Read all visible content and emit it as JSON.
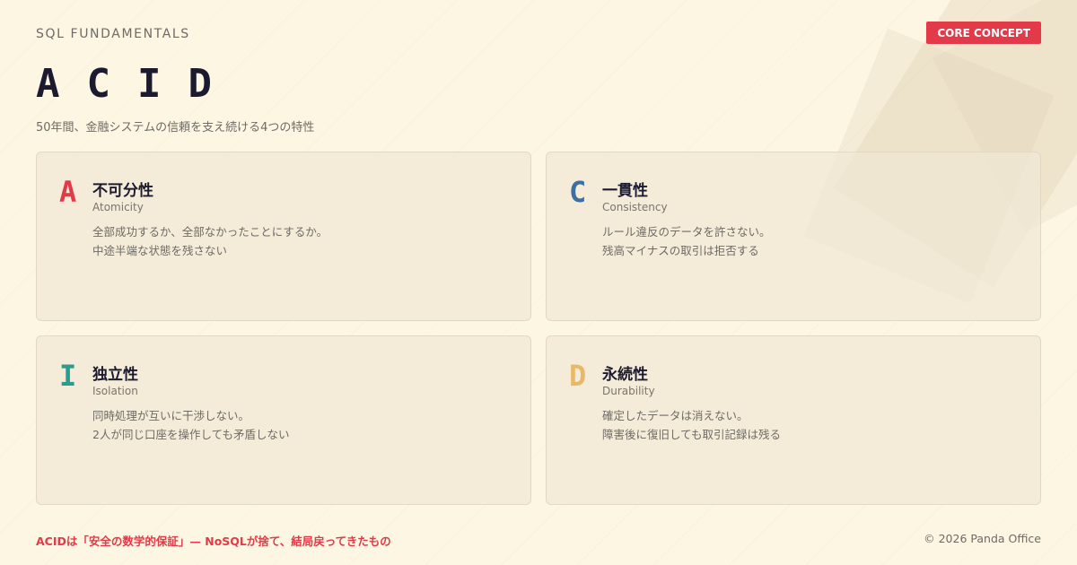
{
  "eyebrow": "SQL FUNDAMENTALS",
  "badge": "CORE CONCEPT",
  "title": "ACID",
  "subtitle": "50年間、金融システムの信頼を支え続ける4つの特性",
  "colors": {
    "red": "#e23a48",
    "blue": "#3d6fa3",
    "teal": "#2a9d8f",
    "gold": "#e9b96a"
  },
  "cards": [
    {
      "letter": "A",
      "name": "不可分性",
      "english": "Atomicity",
      "line1": "全部成功するか、全部なかったことにするか。",
      "line2": "中途半端な状態を残さない"
    },
    {
      "letter": "C",
      "name": "一貫性",
      "english": "Consistency",
      "line1": "ルール違反のデータを許さない。",
      "line2": "残高マイナスの取引は拒否する"
    },
    {
      "letter": "I",
      "name": "独立性",
      "english": "Isolation",
      "line1": "同時処理が互いに干渉しない。",
      "line2": "2人が同じ口座を操作しても矛盾しない"
    },
    {
      "letter": "D",
      "name": "永続性",
      "english": "Durability",
      "line1": "確定したデータは消えない。",
      "line2": "障害後に復旧しても取引記録は残る"
    }
  ],
  "footer": {
    "note": "ACIDは「安全の数学的保証」— NoSQLが捨て、結局戻ってきたもの",
    "copyright": "© 2026 Panda Office"
  }
}
